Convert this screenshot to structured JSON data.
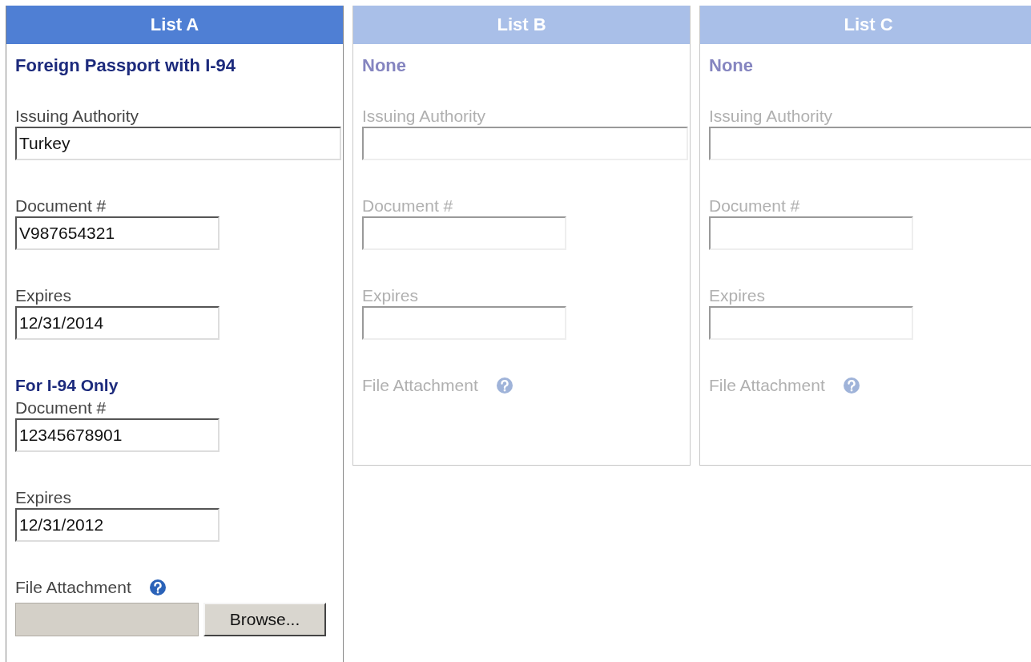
{
  "lists": [
    {
      "header": "List A",
      "disabled": false,
      "title": "Foreign Passport with I-94",
      "items": [
        {
          "kind": "text",
          "label": "Issuing Authority",
          "value": "Turkey",
          "wide": true
        },
        {
          "kind": "text",
          "label": "Document #",
          "value": "V987654321",
          "wide": false
        },
        {
          "kind": "text",
          "label": "Expires",
          "value": "12/31/2014",
          "wide": false
        },
        {
          "kind": "section",
          "label": "For I-94 Only"
        },
        {
          "kind": "text",
          "label": "Document #",
          "value": "12345678901",
          "wide": false
        },
        {
          "kind": "text",
          "label": "Expires",
          "value": "12/31/2012",
          "wide": false
        },
        {
          "kind": "file",
          "label": "File Attachment",
          "button": "Browse..."
        }
      ]
    },
    {
      "header": "List B",
      "disabled": true,
      "title": "None",
      "items": [
        {
          "kind": "text",
          "label": "Issuing Authority",
          "wide": true
        },
        {
          "kind": "text",
          "label": "Document #",
          "wide": false
        },
        {
          "kind": "text",
          "label": "Expires",
          "wide": false
        },
        {
          "kind": "file",
          "label": "File Attachment"
        }
      ]
    },
    {
      "header": "List C",
      "disabled": true,
      "title": "None",
      "items": [
        {
          "kind": "text",
          "label": "Issuing Authority",
          "wide": true
        },
        {
          "kind": "text",
          "label": "Document #",
          "wide": false
        },
        {
          "kind": "text",
          "label": "Expires",
          "wide": false
        },
        {
          "kind": "file",
          "label": "File Attachment"
        }
      ]
    }
  ]
}
